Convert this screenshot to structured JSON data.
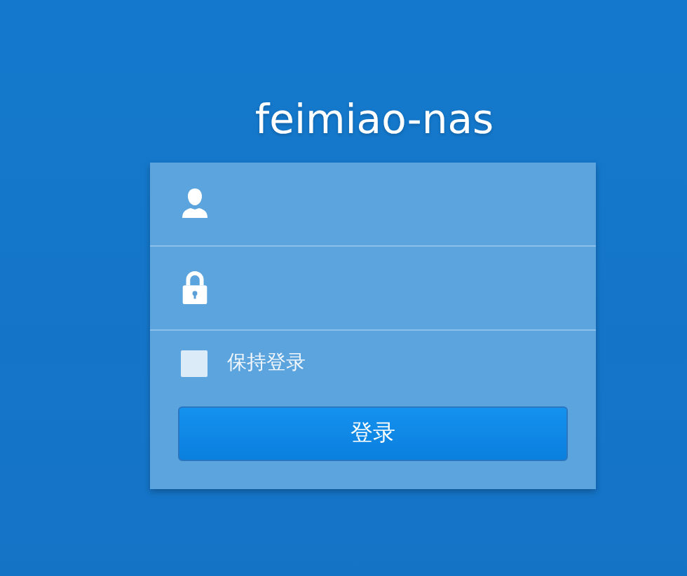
{
  "title": "feimiao-nas",
  "form": {
    "remember": {
      "label": "保持登录",
      "checked": false
    },
    "submit": {
      "label": "登录"
    }
  }
}
